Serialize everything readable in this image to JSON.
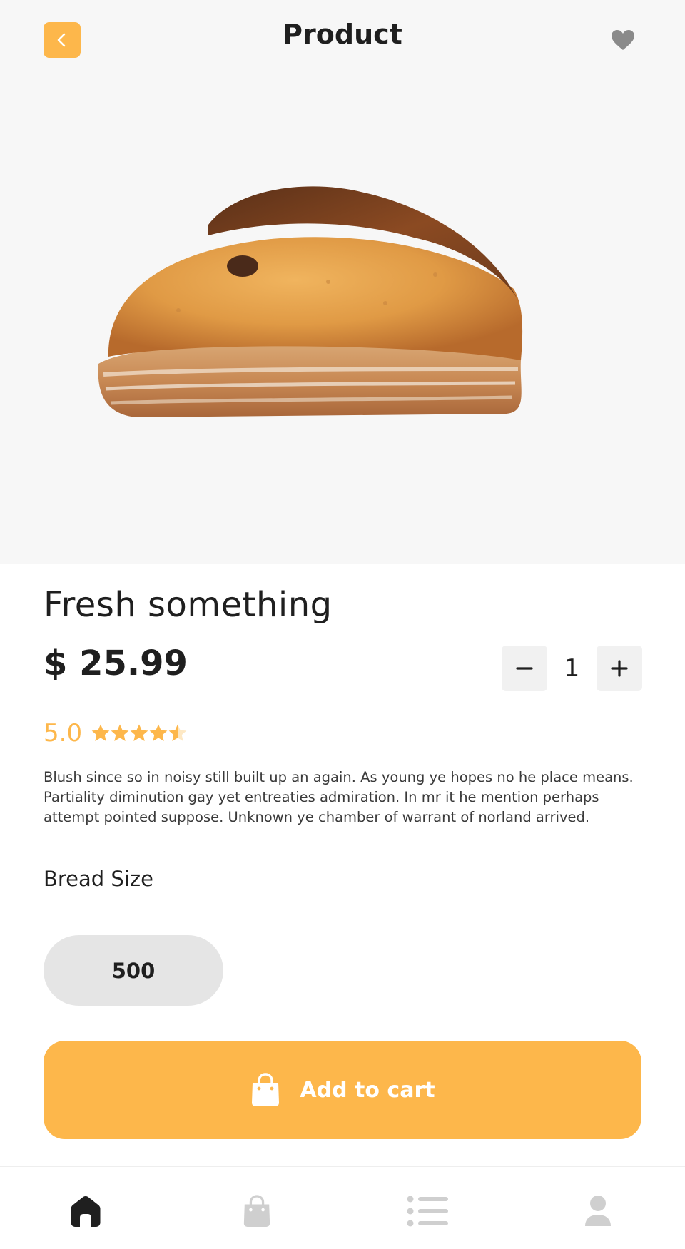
{
  "header": {
    "title": "Product",
    "back_icon": "chevron-left-icon",
    "favorite_icon": "heart-icon"
  },
  "product": {
    "image": "bread-loaf-image",
    "name": "Fresh something",
    "price": "$ 25.99",
    "quantity": "1",
    "rating": {
      "value": "5.0",
      "stars_filled": 4.5,
      "stars_total": 5
    },
    "description": "Blush since so in noisy still built up an again. As young ye hopes no he place means. Partiality diminution gay yet entreaties admiration. In mr it he mention perhaps attempt pointed suppose. Unknown ye chamber of warrant of norland arrived."
  },
  "size_section": {
    "label": "Bread Size",
    "selected": "500"
  },
  "cart_button": {
    "label": "Add to cart",
    "icon": "shopping-bag-icon"
  },
  "tabbar": {
    "items": [
      {
        "icon": "home-icon",
        "active": true
      },
      {
        "icon": "shopping-bag-icon",
        "active": false
      },
      {
        "icon": "list-icon",
        "active": false
      },
      {
        "icon": "user-icon",
        "active": false
      }
    ]
  },
  "colors": {
    "accent": "#fdb74b",
    "text": "#1f1f1f",
    "inactive": "#cfcfcf",
    "hero_bg": "#f7f7f7"
  }
}
